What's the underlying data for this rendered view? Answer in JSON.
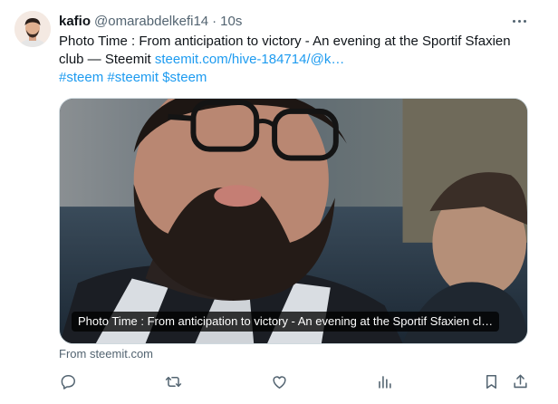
{
  "tweet": {
    "display_name": "kafio",
    "handle": "@omarabdelkefi14",
    "separator": "·",
    "time": "10s",
    "text": "Photo Time : From anticipation to victory - An evening at the Sportif Sfaxien club — Steemit ",
    "link": "steemit.com/hive-184714/@k…",
    "hashtags": "#steem #steemit $steem"
  },
  "media": {
    "caption": "Photo Time : From anticipation to victory - An evening at the Sportif Sfaxien cl…"
  },
  "source": "From steemit.com",
  "icons": {
    "more": "more-icon",
    "reply": "reply-icon",
    "retweet": "retweet-icon",
    "like": "like-icon",
    "views": "views-icon",
    "bookmark": "bookmark-icon",
    "share": "share-icon"
  },
  "colors": {
    "link": "#1d9bf0",
    "secondary_text": "#536471",
    "primary_text": "#0f1419"
  }
}
